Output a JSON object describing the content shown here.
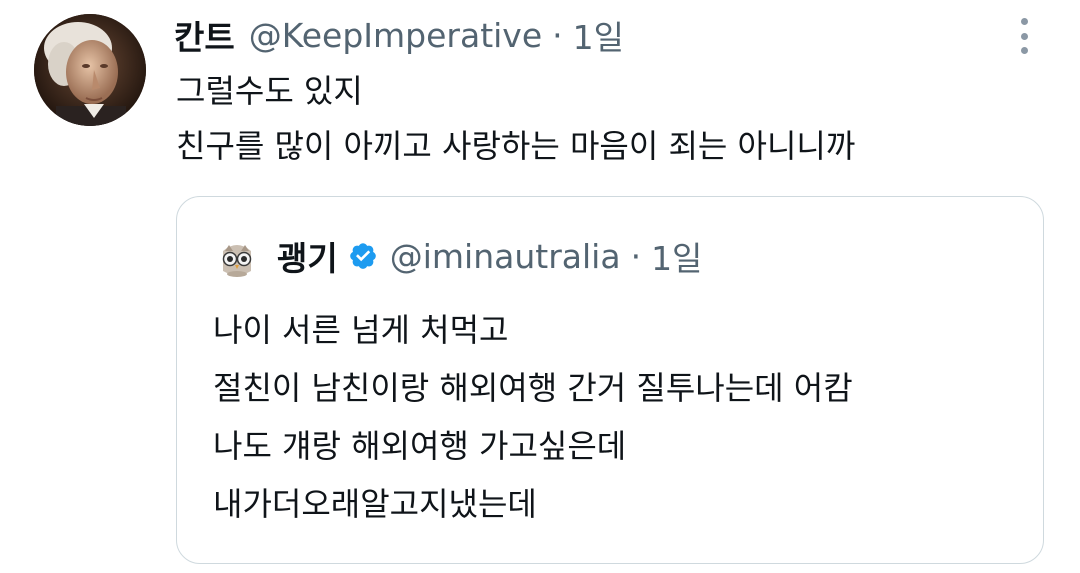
{
  "tweet": {
    "author": {
      "display_name": "칸트",
      "handle": "@KeepImperative",
      "avatar_icon": "portrait-avatar-icon"
    },
    "separator": "·",
    "time": "1일",
    "more_icon": "more-vertical-icon",
    "lines": [
      "그럴수도 있지",
      "친구를 많이 아끼고 사랑하는 마음이 죄는 아니니까"
    ]
  },
  "quote": {
    "author": {
      "display_name": "괭기",
      "handle": "@iminautralia",
      "verified_icon": "verified-badge-icon",
      "verified_color": "#1d9bf0",
      "avatar_icon": "owl-avatar-icon"
    },
    "separator": "·",
    "time": "1일",
    "lines": [
      "나이 서른 넘게 처먹고",
      "절친이 남친이랑 해외여행 간거 질투나는데 어캄",
      "나도 걔랑 해외여행 가고싶은데",
      "내가더오래알고지냈는데"
    ]
  },
  "colors": {
    "text_primary": "#0f1419",
    "text_secondary": "#536471",
    "border": "#cfd9de"
  }
}
